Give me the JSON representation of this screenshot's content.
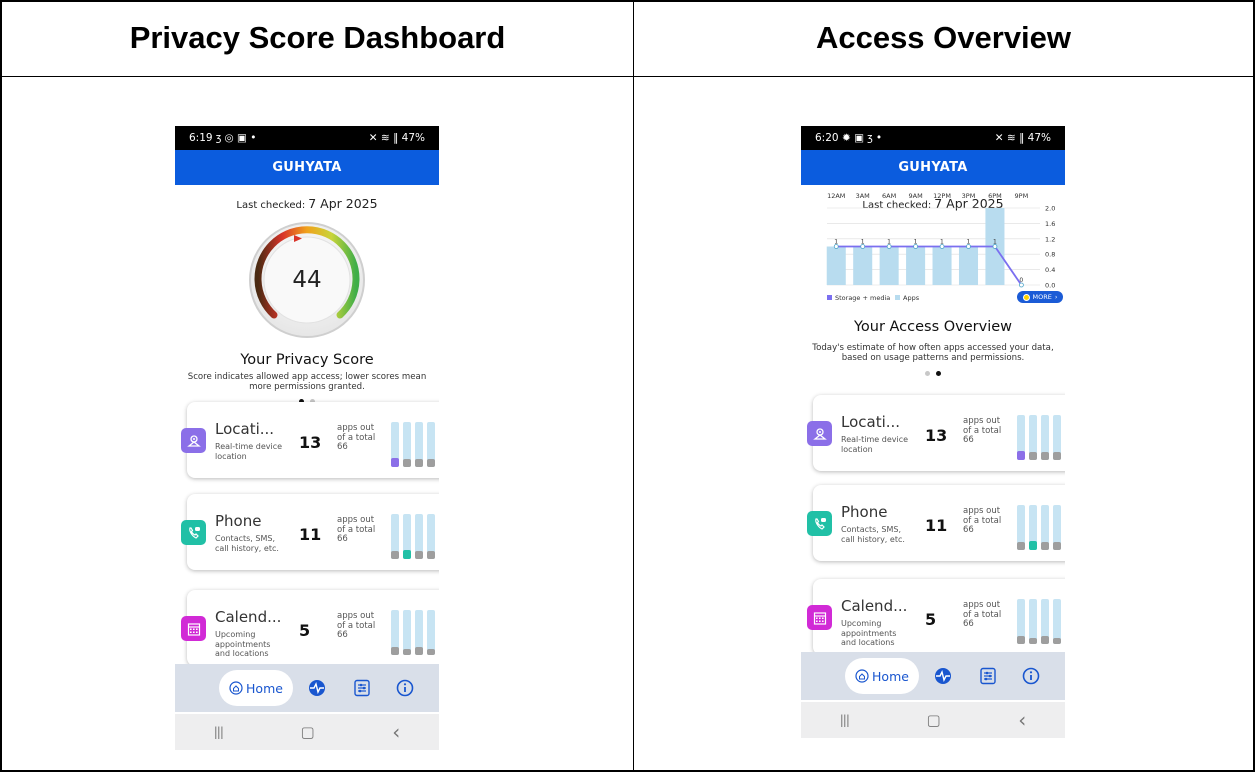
{
  "panels": {
    "left": {
      "title": "Privacy Score Dashboard"
    },
    "right": {
      "title": "Access Overview"
    }
  },
  "screen1": {
    "status": {
      "time": "6:19",
      "left_icons": "ⳅ ◎ ▣ •",
      "right_icons": "✕ ≋ ‖ 47%"
    },
    "app_title": "GUHYATA",
    "last_checked_label": "Last checked:",
    "last_checked_date": "7 Apr 2025",
    "score": "44",
    "score_value": 44,
    "section_title": "Your Privacy Score",
    "section_desc": "Score indicates allowed app access; lower scores mean more permissions granted.",
    "page_indicator": {
      "active": 0,
      "count": 2
    }
  },
  "screen2": {
    "status": {
      "time": "6:20",
      "left_icons": "✹ ▣ ⳅ •",
      "right_icons": "✕ ≋ ‖ 47%"
    },
    "app_title": "GUHYATA",
    "last_checked_label": "Last checked:",
    "last_checked_date": "7 Apr 2025",
    "section_title": "Your Access Overview",
    "section_desc": "Today's estimate of how often apps accessed your data, based on usage patterns and permissions.",
    "page_indicator": {
      "active": 1,
      "count": 2
    },
    "more_label": "MORE",
    "chart_data": {
      "type": "bar",
      "categories": [
        "12AM",
        "3AM",
        "6AM",
        "9AM",
        "12PM",
        "3PM",
        "6PM",
        "9PM"
      ],
      "series": [
        {
          "name": "Storage + media",
          "type": "line",
          "values": [
            1,
            1,
            1,
            1,
            1,
            1,
            1,
            0
          ],
          "color": "#7b6ff0"
        },
        {
          "name": "Apps",
          "type": "bar",
          "values": [
            1,
            1,
            1,
            1,
            1,
            1,
            2,
            0
          ],
          "color": "#b8dcef"
        }
      ],
      "data_labels": [
        "1",
        "1",
        "1",
        "1",
        "1",
        "1",
        "1",
        "0"
      ],
      "ylim": [
        0,
        2.0
      ],
      "y_ticks": [
        "2.0",
        "1.6",
        "1.2",
        "0.8",
        "0.4",
        "0.0"
      ],
      "y_tick_values": [
        2.0,
        1.6,
        1.2,
        0.8,
        0.4,
        0.0
      ],
      "legend_position": "bottom-left"
    }
  },
  "cards": [
    {
      "name": "Locati...",
      "desc": "Real-time device location",
      "count": "13",
      "total_text": "apps out of a total 66",
      "icon": "location-icon",
      "color": "#8b6fe8",
      "highlight_bar": 0
    },
    {
      "name": "Phone",
      "desc": "Contacts, SMS, call history, etc.",
      "count": "11",
      "total_text": "apps out of a total 66",
      "icon": "phone-icon",
      "color": "#21c0a6",
      "highlight_bar": 1
    },
    {
      "name": "Calend...",
      "desc": "Upcoming appointments and locations",
      "count": "5",
      "total_text": "apps out of a total 66",
      "icon": "calendar-icon",
      "color": "#d12ad6",
      "highlight_bar": -1
    }
  ],
  "nav": {
    "home_label": "Home",
    "items": [
      "activity-icon",
      "settings-sliders-icon",
      "info-icon"
    ]
  },
  "system_nav": {
    "recents": "|||",
    "home": "▢",
    "back": "‹"
  },
  "colors": {
    "app_blue": "#0b5cde",
    "nav_bg": "#d9dfe9"
  }
}
